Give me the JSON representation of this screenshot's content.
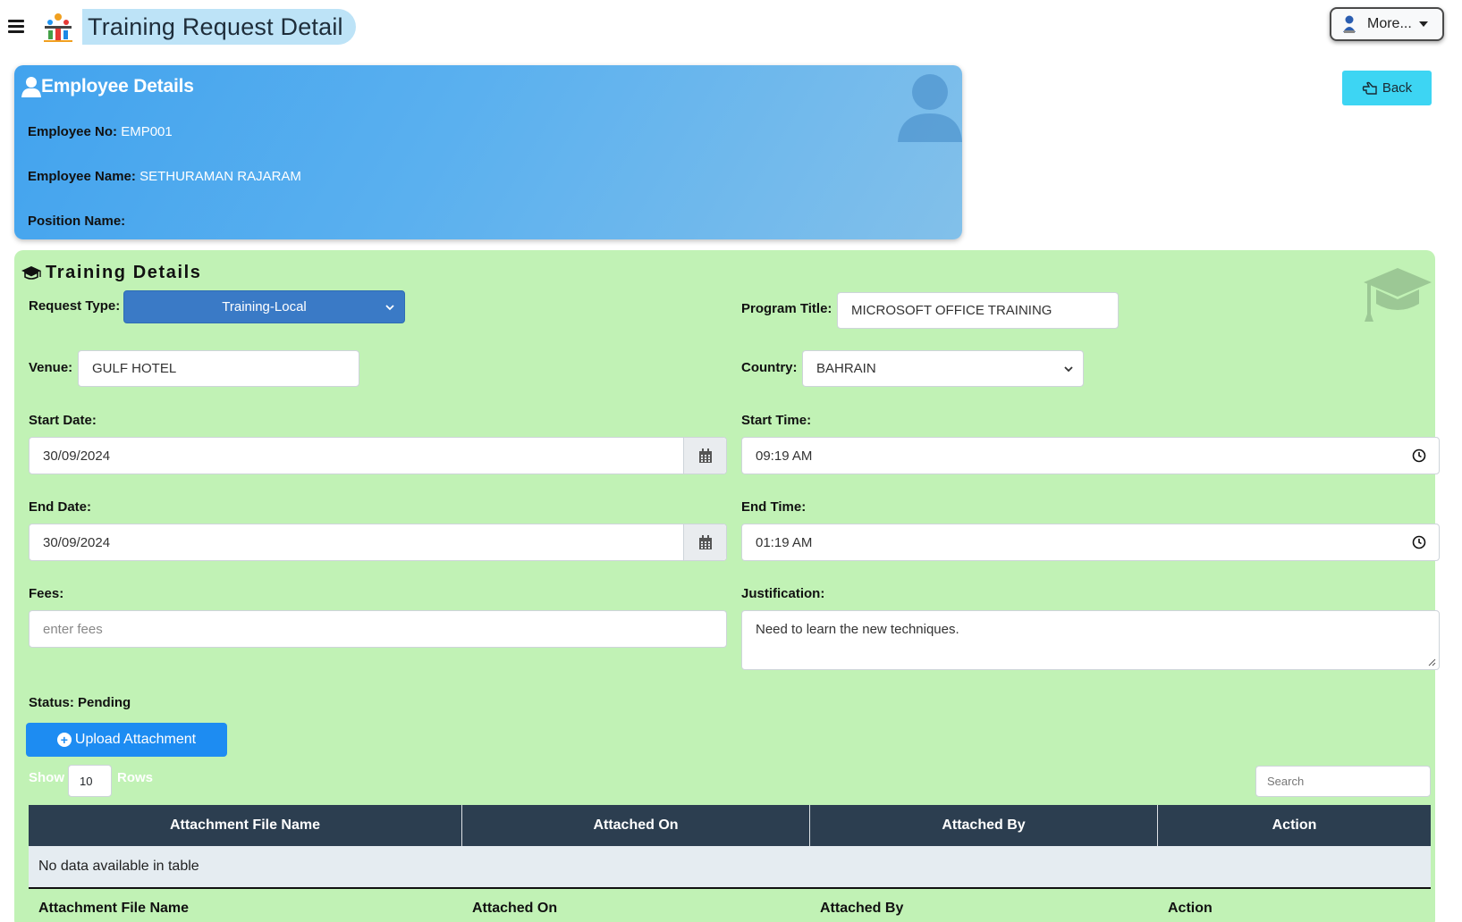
{
  "header": {
    "title": "Training Request Detail",
    "more_label": "More..."
  },
  "back_label": "Back",
  "employee": {
    "section_title": "Employee Details",
    "no_label": "Employee No:",
    "no_value": "EMP001",
    "name_label": "Employee Name:",
    "name_value": "SETHURAMAN RAJARAM",
    "position_label": "Position Name:",
    "position_value": ""
  },
  "training": {
    "section_title": "Training Details",
    "request_type_label": "Request Type:",
    "request_type_value": "Training-Local",
    "program_title_label": "Program Title:",
    "program_title_value": "MICROSOFT OFFICE TRAINING",
    "venue_label": "Venue:",
    "venue_value": "GULF HOTEL",
    "country_label": "Country:",
    "country_value": "BAHRAIN",
    "start_date_label": "Start Date:",
    "start_date_value": "30/09/2024",
    "start_time_label": "Start Time:",
    "start_time_value": "09:19  AM",
    "end_date_label": "End Date:",
    "end_date_value": "30/09/2024",
    "end_time_label": "End Time:",
    "end_time_value": "01:19  AM",
    "fees_label": "Fees:",
    "fees_placeholder": "enter fees",
    "justification_label": "Justification:",
    "justification_value": "Need to learn the new techniques.",
    "status_label": "Status:",
    "status_value": "Pending",
    "upload_label": "Upload Attachment"
  },
  "table": {
    "show_label": "Show",
    "rows_value": "10",
    "rows_label": "Rows",
    "search_placeholder": "Search",
    "columns": [
      "Attachment File Name",
      "Attached On",
      "Attached By",
      "Action"
    ],
    "empty_text": "No data available in table"
  },
  "colors": {
    "employee_card": "#42a3ee",
    "training_card": "#c1f2b5",
    "table_header": "#2c3e50",
    "primary_button": "#1d8cf2",
    "back_button": "#3dd5f3"
  }
}
